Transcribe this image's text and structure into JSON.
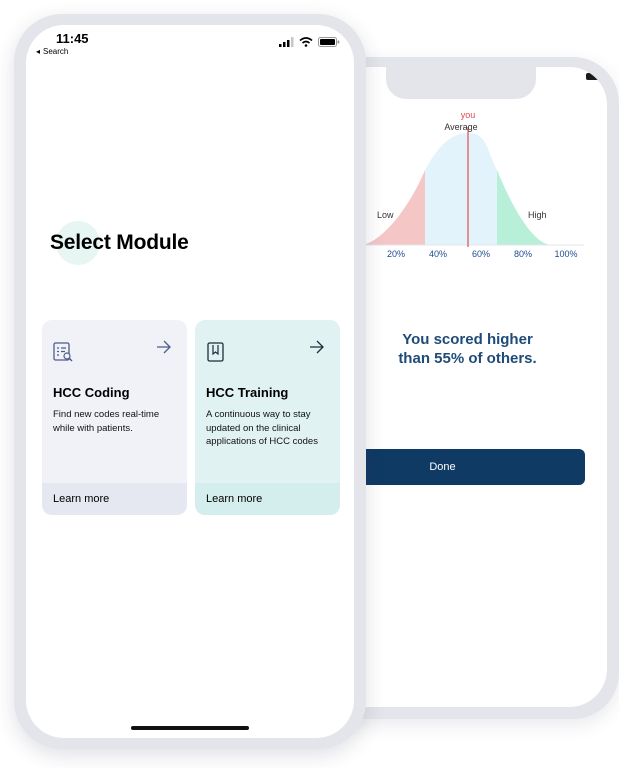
{
  "results_screen": {
    "chart_data": {
      "type": "area",
      "x_ticks": [
        "20%",
        "40%",
        "60%",
        "80%",
        "100%"
      ],
      "bands": [
        {
          "name": "Low",
          "color": "#f4c6c6"
        },
        {
          "name": "Average",
          "color": "#e2f3fb"
        },
        {
          "name": "High",
          "color": "#b8efd9"
        }
      ],
      "marker": {
        "label": "you",
        "value": 55,
        "color": "#e24b50"
      },
      "average_label": "Average",
      "low_label": "Low",
      "high_label": "High"
    },
    "score_line1": "You scored higher",
    "score_line2": "than 55% of others.",
    "done_label": "Done"
  },
  "status_bar": {
    "time": "11:45",
    "back_label": "Search"
  },
  "page_title": "Select Module",
  "modules": [
    {
      "title": "HCC Coding",
      "description": "Find new codes real-time while with patients.",
      "link": "Learn more",
      "icon": "document-search-icon"
    },
    {
      "title": "HCC Training",
      "description": "A continuous way to stay updated on the clinical applications of HCC codes",
      "link": "Learn more",
      "icon": "book-icon"
    }
  ],
  "colors": {
    "accent_navy": "#0f3a63",
    "score_text": "#1f4b78",
    "marker_red": "#e24b50"
  }
}
